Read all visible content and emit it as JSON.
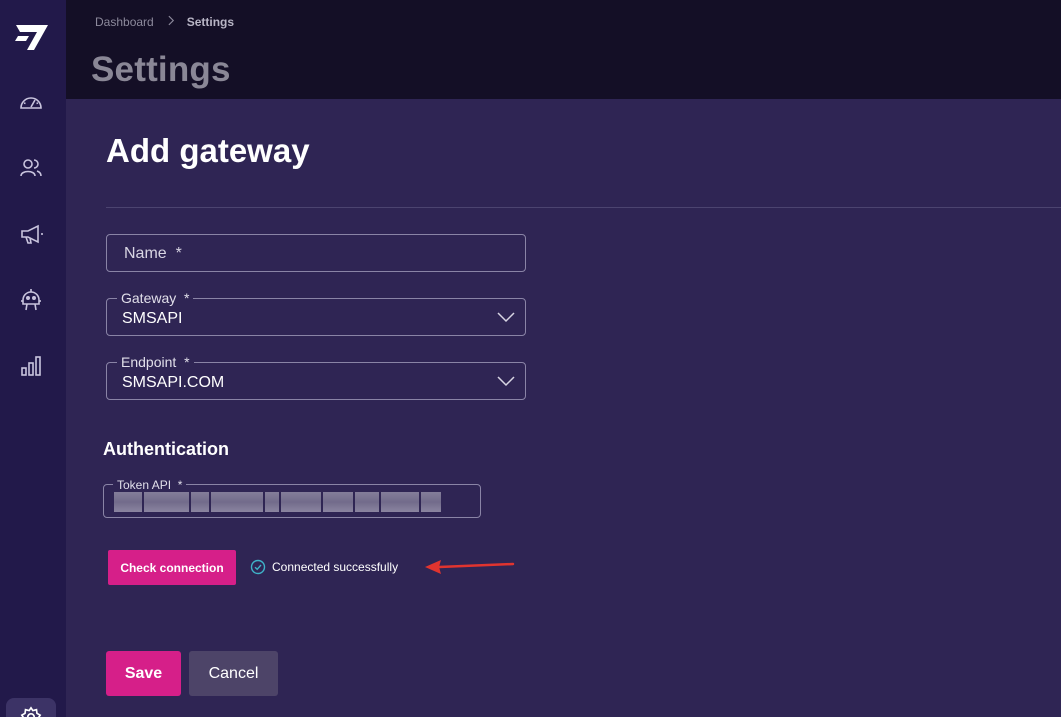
{
  "breadcrumb": {
    "home": "Dashboard",
    "current": "Settings"
  },
  "header": {
    "title": "Settings"
  },
  "sidebar": {
    "items": [
      {
        "icon": "dashboard-gauge-icon"
      },
      {
        "icon": "users-icon"
      },
      {
        "icon": "megaphone-icon"
      },
      {
        "icon": "robot-icon"
      },
      {
        "icon": "bar-chart-icon"
      },
      {
        "icon": "settings-gear-icon"
      }
    ]
  },
  "form": {
    "title": "Add gateway",
    "name": {
      "placeholder": "Name",
      "required": "*"
    },
    "gateway": {
      "label": "Gateway",
      "required": "*",
      "value": "SMSAPI"
    },
    "endpoint": {
      "label": "Endpoint",
      "required": "*",
      "value": "SMSAPI.COM"
    },
    "auth_section": "Authentication",
    "token": {
      "label": "Token API",
      "required": "*"
    },
    "check_button": "Check connection",
    "status_text": "Connected successfully",
    "save_button": "Save",
    "cancel_button": "Cancel"
  },
  "colors": {
    "accent": "#d61f89",
    "sidebar": "#22194a",
    "topbar": "#140f26",
    "content": "#2f2554",
    "success": "#3fb3c9",
    "annotation_arrow": "#e0342f"
  }
}
